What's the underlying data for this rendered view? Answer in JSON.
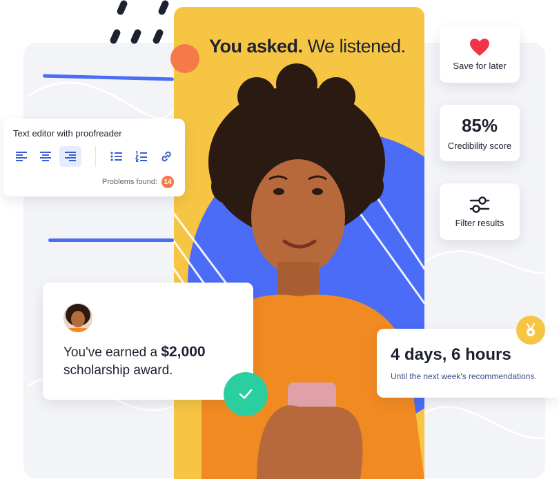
{
  "hero": {
    "title_bold": "You asked.",
    "title_rest": " We listened."
  },
  "save_card": {
    "icon": "heart-icon",
    "label": "Save for later"
  },
  "credibility_card": {
    "value": "85%",
    "label": "Credibility score"
  },
  "filter_card": {
    "icon": "sliders-icon",
    "label": "Filter results"
  },
  "editor": {
    "title": "Text editor with proofreader",
    "tools": [
      "align-left-icon",
      "align-center-icon",
      "align-right-icon",
      "bullet-list-icon",
      "numbered-list-icon",
      "link-icon"
    ],
    "active_tool": "align-right-icon",
    "problems_label": "Problems found:",
    "problems_count": "14"
  },
  "award": {
    "text_prefix": "You've earned a ",
    "amount": "$2,000",
    "text_suffix": "scholarship award."
  },
  "countdown": {
    "value": "4 days, 6 hours",
    "subtitle": "Until the next week's recommendations."
  },
  "colors": {
    "accent_yellow": "#f7c544",
    "accent_blue": "#4a6cf7",
    "accent_orange": "#f47a4a",
    "accent_green": "#2bcf9f",
    "heart_red": "#f0354b",
    "text_dark": "#1e2230"
  }
}
